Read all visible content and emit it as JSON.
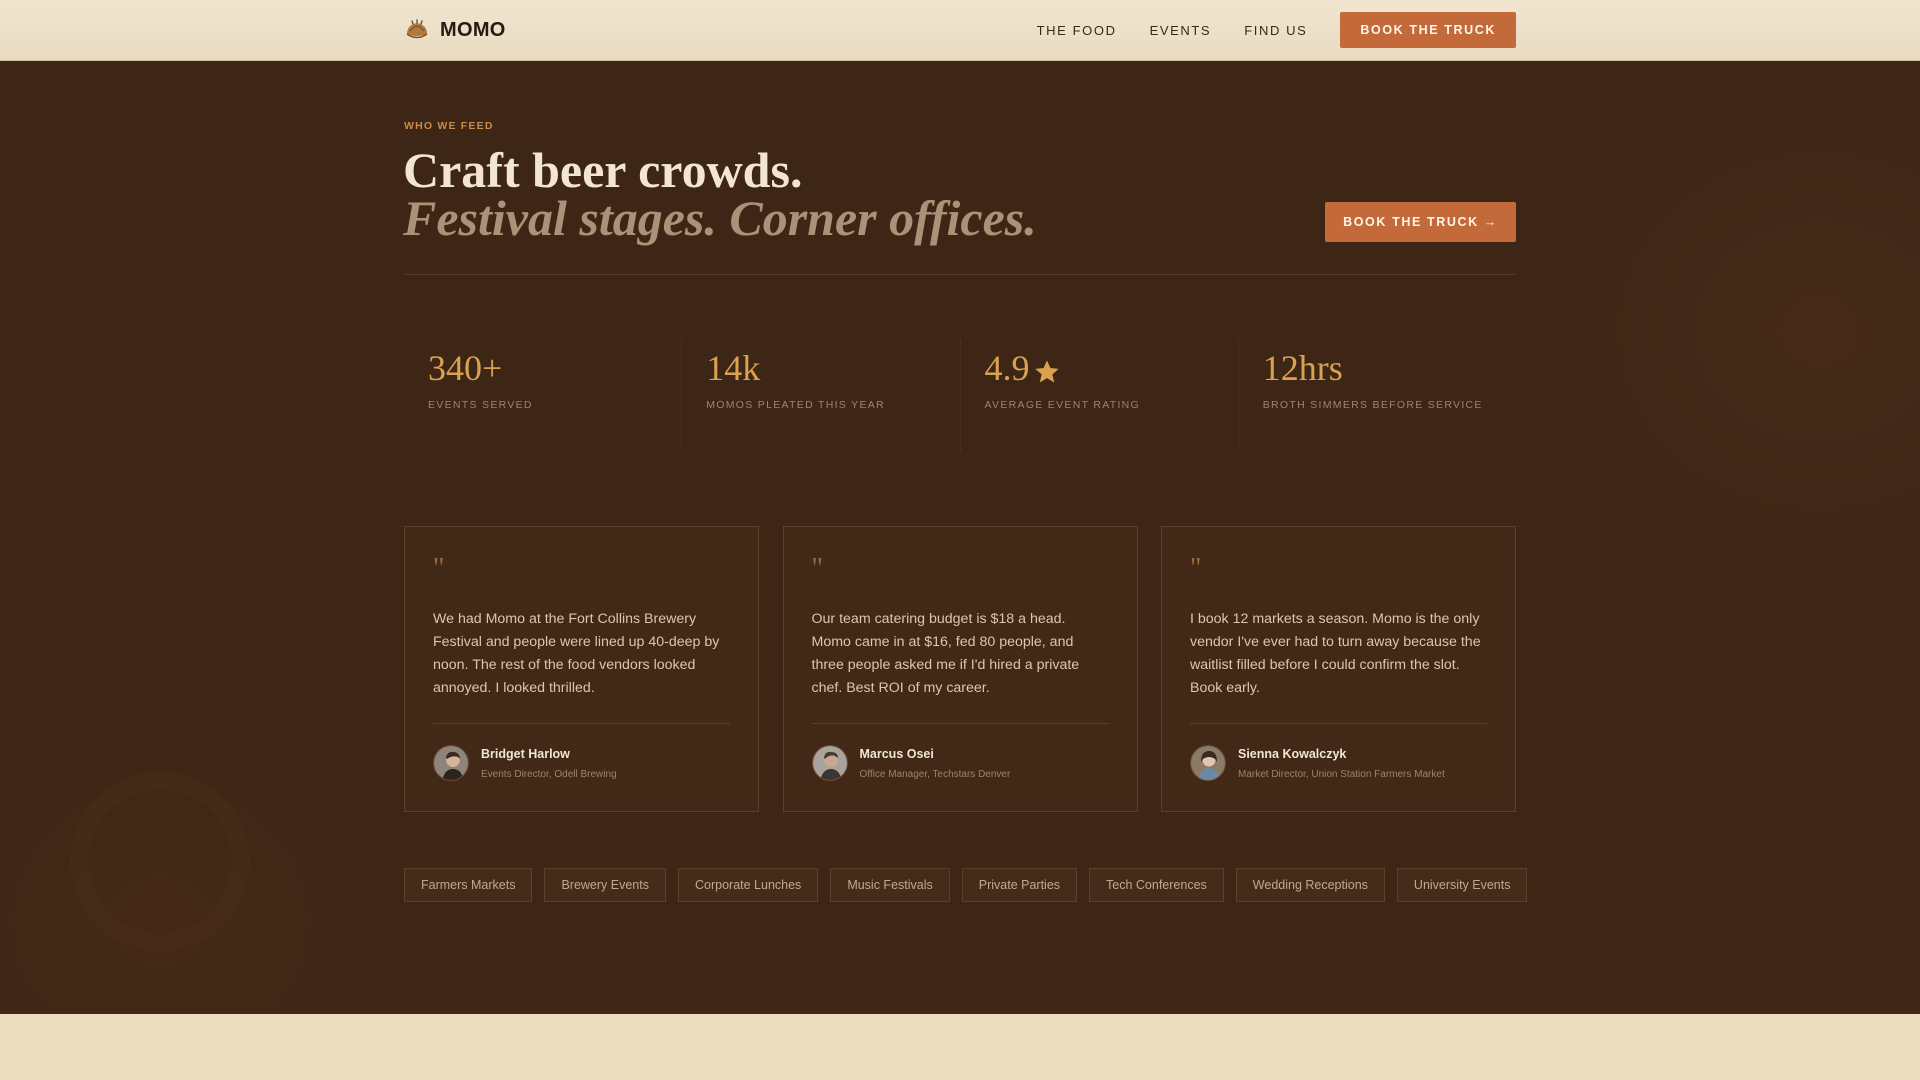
{
  "header": {
    "brand": "MOMO",
    "logo_icon": "dumpling-icon",
    "nav": [
      "THE FOOD",
      "EVENTS",
      "FIND US"
    ],
    "cta": "BOOK THE TRUCK"
  },
  "hero": {
    "eyebrow": "WHO WE FEED",
    "headline_line1": "Craft beer crowds.",
    "headline_line2": "Festival stages. Corner offices.",
    "cta": "BOOK THE TRUCK →"
  },
  "stats": [
    {
      "value": "340+",
      "label": "EVENTS SERVED"
    },
    {
      "value": "14k",
      "label": "MOMOS PLEATED THIS YEAR"
    },
    {
      "value": "4.9",
      "label": "AVERAGE EVENT RATING",
      "icon": "star-icon"
    },
    {
      "value": "12hrs",
      "label": "BROTH SIMMERS BEFORE SERVICE"
    }
  ],
  "testimonials": [
    {
      "quote_mark": "\"",
      "quote": "We had Momo at the Fort Collins Brewery Festival and people were lined up 40-deep by noon. The rest of the food vendors looked annoyed. I looked thrilled.",
      "name": "Bridget Harlow",
      "role": "Events Director, Odell Brewing"
    },
    {
      "quote_mark": "\"",
      "quote": "Our team catering budget is $18 a head. Momo came in at $16, fed 80 people, and three people asked me if I'd hired a private chef. Best ROI of my career.",
      "name": "Marcus Osei",
      "role": "Office Manager, Techstars Denver"
    },
    {
      "quote_mark": "\"",
      "quote": "I book 12 markets a season. Momo is the only vendor I've ever had to turn away because the waitlist filled before I could confirm the slot. Book early.",
      "name": "Sienna Kowalczyk",
      "role": "Market Director, Union Station Farmers Market"
    }
  ],
  "tags": [
    "Farmers Markets",
    "Brewery Events",
    "Corporate Lunches",
    "Music Festivals",
    "Private Parties",
    "Tech Conferences",
    "Wedding Receptions",
    "University Events"
  ],
  "colors": {
    "accent": "#c46a3a",
    "gold": "#d9a24e",
    "background_dark": "#3e2616",
    "background_light": "#ecdcc0"
  }
}
